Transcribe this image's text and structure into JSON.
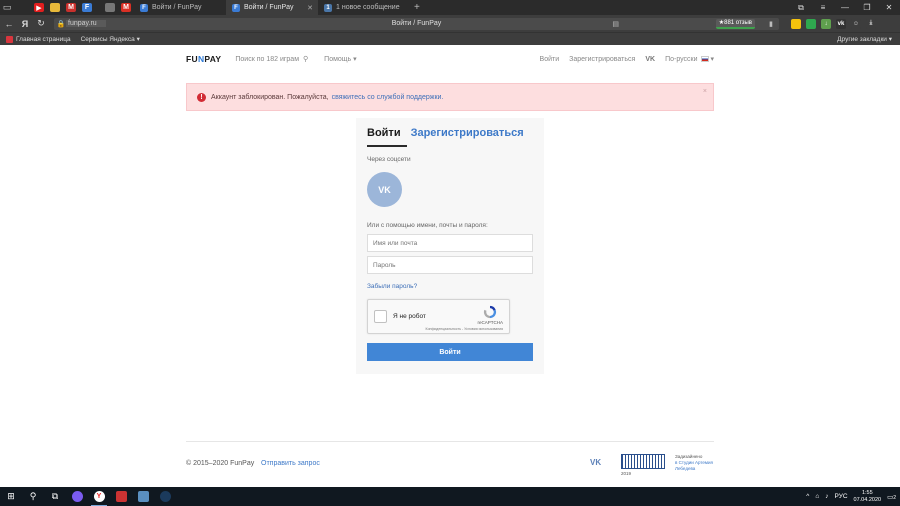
{
  "browser": {
    "tabs": [
      {
        "label": "Войти / FunPay",
        "active": false
      },
      {
        "label": "Войти / FunPay",
        "active": true
      },
      {
        "label": "1 новое сообщение",
        "active": false
      }
    ],
    "url": "funpay.ru",
    "page_title": "Войти / FunPay",
    "reviews_badge": "★881 отзыв",
    "bookmarks": [
      {
        "label": "Главная страница"
      },
      {
        "label": "Сервисы Яндекса ▾"
      }
    ],
    "other_bookmarks": "Другие закладки ▾"
  },
  "header": {
    "logo_prefix": "FU",
    "logo_highlight": "N",
    "logo_suffix": "PAY",
    "search_placeholder": "Поиск по 182 играм",
    "help": "Помощь ▾",
    "login": "Войти",
    "register": "Зарегистрироваться",
    "vk": "VK",
    "language": "По-русски"
  },
  "alert": {
    "text": "Аккаунт заблокирован. Пожалуйста,",
    "link": "свяжитесь со службой поддержки.",
    "close": "×"
  },
  "login_card": {
    "tab_login": "Войти",
    "tab_register": "Зарегистрироваться",
    "social_label": "Через соцсети",
    "vk_button": "VK",
    "or_label": "Или с помощью имени, почты и пароля:",
    "username_placeholder": "Имя или почта",
    "password_placeholder": "Пароль",
    "forgot": "Забыли пароль?",
    "captcha_label": "Я не робот",
    "captcha_brand": "reCAPTCHA",
    "captcha_terms": "Конфиденциальность - Условия использования",
    "submit": "Войти"
  },
  "footer": {
    "copyright": "© 2015–2020 FunPay",
    "send_request": "Отправить запрос",
    "vk": "VK",
    "barcode_year": "2019",
    "studio_line1": "Задизайнено",
    "studio_line2": "в Студии Артемия",
    "studio_line3": "Лебедева"
  },
  "taskbar": {
    "language": "РУС",
    "time": "1:55",
    "date": "07.04.2020",
    "notifications": "2"
  }
}
